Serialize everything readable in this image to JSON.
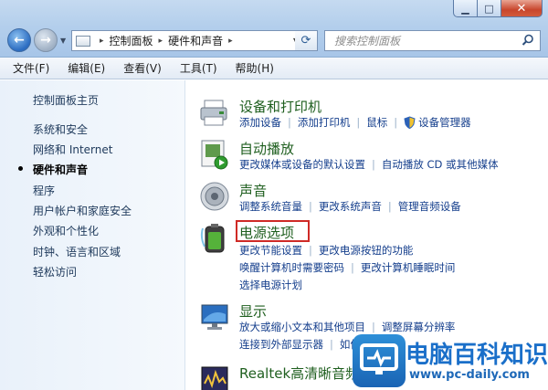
{
  "window": {
    "min_glyph": "▁",
    "max_glyph": "□",
    "close_glyph": "✕"
  },
  "address": {
    "segments": [
      "控制面板",
      "硬件和声音"
    ],
    "separator": "▸"
  },
  "search": {
    "placeholder": "搜索控制面板"
  },
  "menubar": [
    "文件(F)",
    "编辑(E)",
    "查看(V)",
    "工具(T)",
    "帮助(H)"
  ],
  "sidebar": {
    "items": [
      {
        "label": "控制面板主页"
      },
      {
        "label": "系统和安全"
      },
      {
        "label": "网络和 Internet"
      },
      {
        "label": "硬件和声音",
        "active": true
      },
      {
        "label": "程序"
      },
      {
        "label": "用户帐户和家庭安全"
      },
      {
        "label": "外观和个性化"
      },
      {
        "label": "时钟、语言和区域"
      },
      {
        "label": "轻松访问"
      }
    ]
  },
  "categories": [
    {
      "title": "设备和打印机",
      "icon": "printer-icon",
      "rows": [
        [
          "添加设备",
          "添加打印机",
          "鼠标",
          "设备管理器"
        ]
      ]
    },
    {
      "title": "自动播放",
      "icon": "autoplay-icon",
      "rows": [
        [
          "更改媒体或设备的默认设置",
          "自动播放 CD 或其他媒体"
        ]
      ]
    },
    {
      "title": "声音",
      "icon": "speaker-icon",
      "rows": [
        [
          "调整系统音量",
          "更改系统声音",
          "管理音频设备"
        ]
      ]
    },
    {
      "title": "电源选项",
      "icon": "battery-icon",
      "highlighted": true,
      "rows": [
        [
          "更改节能设置",
          "更改电源按钮的功能"
        ],
        [
          "唤醒计算机时需要密码",
          "更改计算机睡眠时间"
        ],
        [
          "选择电源计划"
        ]
      ]
    },
    {
      "title": "显示",
      "icon": "monitor-icon",
      "rows": [
        [
          "放大或缩小文本和其他项目",
          "调整屏幕分辨率"
        ],
        [
          "连接到外部显示器",
          "如何"
        ]
      ]
    },
    {
      "title": "Realtek高清晰音频",
      "icon": "realtek-icon",
      "rows": []
    }
  ],
  "watermark": {
    "title": "电脑百科知识",
    "url": "www.pc-daily.com"
  },
  "colors": {
    "highlight_box": "#cf2a26",
    "category_title": "#1f5f1f",
    "link": "#143e8c"
  }
}
